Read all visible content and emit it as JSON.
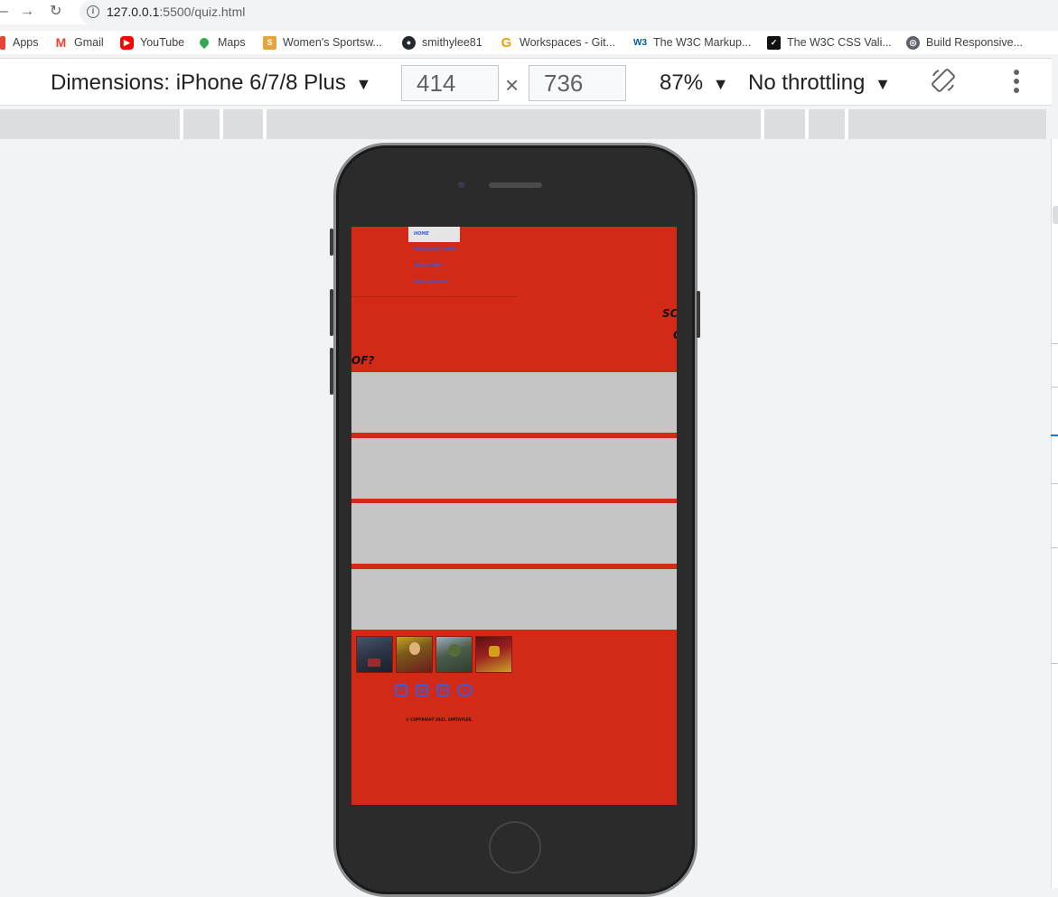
{
  "browser": {
    "url_host": "127.0.0.1",
    "url_path": ":5500/quiz.html"
  },
  "bookmarks": [
    {
      "label": "Apps",
      "icon": "apps-grid-icon",
      "color": "#ea4335"
    },
    {
      "label": "Gmail",
      "icon": "gmail-icon",
      "color": "#ea4335"
    },
    {
      "label": "YouTube",
      "icon": "youtube-icon",
      "color": "#ff0000"
    },
    {
      "label": "Maps",
      "icon": "maps-pin-icon",
      "color": "#34a853"
    },
    {
      "label": "Women's Sportsw...",
      "icon": "sportswear-site-icon",
      "color": "#e8a33d"
    },
    {
      "label": "smithylee81",
      "icon": "github-icon",
      "color": "#24292e"
    },
    {
      "label": "Workspaces - Git...",
      "icon": "gitpod-icon",
      "color": "#f59e0b"
    },
    {
      "label": "The W3C Markup...",
      "icon": "w3c-icon",
      "color": "#005a9c"
    },
    {
      "label": "The W3C CSS Vali...",
      "icon": "css-validator-icon",
      "color": "#111111"
    },
    {
      "label": "Build Responsive...",
      "icon": "globe-icon",
      "color": "#5f6368"
    }
  ],
  "devtools": {
    "dimensions_label": "Dimensions: iPhone 6/7/8 Plus",
    "width": "414",
    "height": "736",
    "times": "×",
    "zoom": "87%",
    "throttling": "No throttling",
    "dropdown_arrow": "▼"
  },
  "site": {
    "nav": [
      "HOME",
      "REACHING LINKS",
      "QUIZ SORA",
      "QUIZ SORAS3"
    ],
    "score_label_1": "SCO",
    "score_label_2": "C",
    "question_fragment": "OF?",
    "footer_images": [
      "captain-america",
      "thor",
      "hulk",
      "iron-man"
    ],
    "social_icons": [
      "facebook-icon",
      "instagram-icon",
      "linkedin-icon",
      "discord-icon"
    ],
    "copyright": "© COPYRIGHT 2021. SMITHYLEE."
  }
}
